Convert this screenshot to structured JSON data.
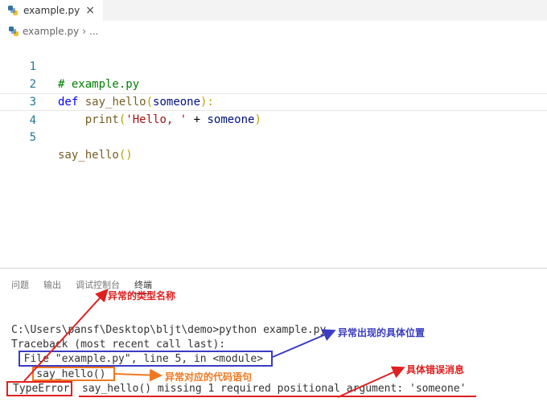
{
  "tab": {
    "filename": "example.py",
    "close_symbol": "×"
  },
  "breadcrumb": {
    "file": "example.py",
    "separator": "›",
    "ellipsis": "..."
  },
  "editor": {
    "lines": [
      {
        "number": "1",
        "comment": "# example.py"
      },
      {
        "number": "2",
        "keyword": "def",
        "function": "say_hello",
        "open": "(",
        "param": "someone",
        "close": "):"
      },
      {
        "number": "3",
        "indent": "    ",
        "function": "print",
        "open": "(",
        "string": "'Hello, '",
        "operator": " + ",
        "param": "someone",
        "close": ")"
      },
      {
        "number": "4"
      },
      {
        "number": "5",
        "function": "say_hello",
        "parens": "()"
      }
    ]
  },
  "panel": {
    "tabs": [
      "问题",
      "输出",
      "调试控制台",
      "终端"
    ],
    "active_tab": "终端"
  },
  "terminal": {
    "command_line": "C:\\Users\\pansf\\Desktop\\bljt\\demo>python example.py",
    "traceback_line": "Traceback (most recent call last):",
    "file_line": "  File \"example.py\", line 5, in <module>",
    "code_line": "    say_hello()",
    "error_type": "TypeError",
    "error_message": "say_hello() missing 1 required positional argument: 'someone'"
  },
  "annotations": {
    "error_type": {
      "text": "异常的类型名称",
      "color": "#e02020"
    },
    "location": {
      "text": "异常出现的具体位置",
      "color": "#3b3bc4"
    },
    "code": {
      "text": "异常对应的代码语句",
      "color": "#f07820"
    },
    "message": {
      "text": "具体错误消息",
      "color": "#e02020"
    }
  }
}
